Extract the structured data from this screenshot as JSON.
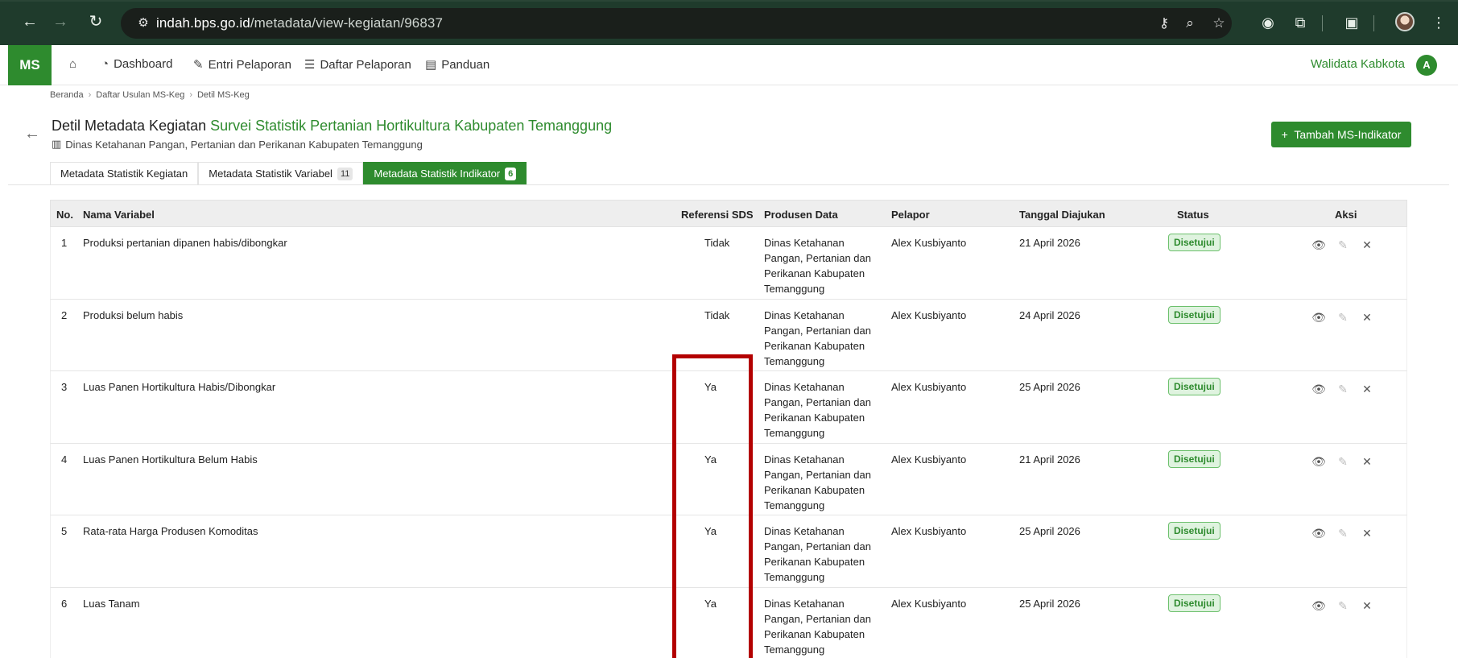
{
  "browser": {
    "url_host": "indah.bps.go.id",
    "url_path": "/metadata/view-kegiatan/96837"
  },
  "app": {
    "logo": "MS",
    "nav": [
      {
        "label": "Dashboard",
        "icon": "dashboard-icon"
      },
      {
        "label": "Entri Pelaporan",
        "icon": "pencil-icon"
      },
      {
        "label": "Daftar Pelaporan",
        "icon": "list-icon"
      },
      {
        "label": "Panduan",
        "icon": "book-icon"
      }
    ],
    "user_role": "Walidata Kabkota",
    "avatar_initial": "A"
  },
  "breadcrumb": [
    "Beranda",
    "Daftar Usulan MS-Keg",
    "Detil MS-Keg"
  ],
  "header": {
    "title_prefix": "Detil Metadata Kegiatan",
    "title_highlight": "Survei Statistik Pertanian Hortikultura Kabupaten Temanggung",
    "subtitle": "Dinas Ketahanan Pangan, Pertanian dan Perikanan Kabupaten Temanggung",
    "add_button": "Tambah MS-Indikator"
  },
  "tabs": [
    {
      "label": "Metadata Statistik Kegiatan",
      "count": null,
      "active": false
    },
    {
      "label": "Metadata Statistik Variabel",
      "count": "11",
      "active": false
    },
    {
      "label": "Metadata Statistik Indikator",
      "count": "6",
      "active": true
    }
  ],
  "table": {
    "headers": {
      "no": "No.",
      "nama": "Nama Variabel",
      "ref": "Referensi SDS",
      "prod": "Produsen Data",
      "pelapor": "Pelapor",
      "tanggal": "Tanggal Diajukan",
      "status": "Status",
      "aksi": "Aksi"
    },
    "rows": [
      {
        "no": "1",
        "nama": "Produksi pertanian dipanen habis/dibongkar",
        "ref": "Tidak",
        "prod": "Dinas Ketahanan Pangan, Pertanian dan Perikanan Kabupaten Temanggung",
        "pelapor": "Alex Kusbiyanto",
        "tanggal": "21 April 2026",
        "status": "Disetujui"
      },
      {
        "no": "2",
        "nama": "Produksi belum habis",
        "ref": "Tidak",
        "prod": "Dinas Ketahanan Pangan, Pertanian dan Perikanan Kabupaten Temanggung",
        "pelapor": "Alex Kusbiyanto",
        "tanggal": "24 April 2026",
        "status": "Disetujui"
      },
      {
        "no": "3",
        "nama": "Luas Panen Hortikultura Habis/Dibongkar",
        "ref": "Ya",
        "prod": "Dinas Ketahanan Pangan, Pertanian dan Perikanan Kabupaten Temanggung",
        "pelapor": "Alex Kusbiyanto",
        "tanggal": "25 April 2026",
        "status": "Disetujui"
      },
      {
        "no": "4",
        "nama": "Luas Panen Hortikultura Belum Habis",
        "ref": "Ya",
        "prod": "Dinas Ketahanan Pangan, Pertanian dan Perikanan Kabupaten Temanggung",
        "pelapor": "Alex Kusbiyanto",
        "tanggal": "21 April 2026",
        "status": "Disetujui"
      },
      {
        "no": "5",
        "nama": "Rata-rata Harga Produsen Komoditas",
        "ref": "Ya",
        "prod": "Dinas Ketahanan Pangan, Pertanian dan Perikanan Kabupaten Temanggung",
        "pelapor": "Alex Kusbiyanto",
        "tanggal": "25 April 2026",
        "status": "Disetujui"
      },
      {
        "no": "6",
        "nama": "Luas Tanam",
        "ref": "Ya",
        "prod": "Dinas Ketahanan Pangan, Pertanian dan Perikanan Kabupaten Temanggung",
        "pelapor": "Alex Kusbiyanto",
        "tanggal": "25 April 2026",
        "status": "Disetujui"
      }
    ]
  },
  "colors": {
    "brand_green": "#2e8b2e",
    "highlight_red": "#b30000",
    "chrome_bg": "#1f3b2c"
  }
}
